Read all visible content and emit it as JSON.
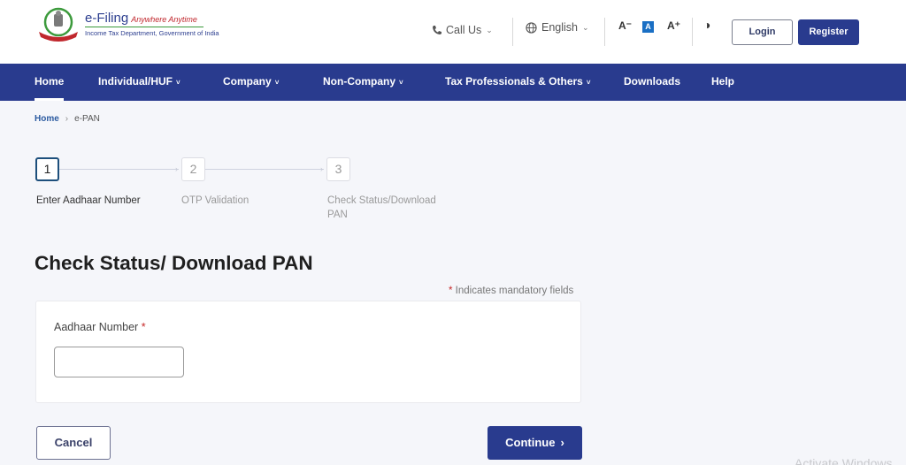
{
  "header": {
    "logo_title": "e-Filing",
    "logo_tagline": "Anywhere Anytime",
    "logo_subtitle": "Income Tax Department, Government of India",
    "call_us": "Call Us",
    "language": "English",
    "font_decrease": "A⁻",
    "font_default": "A",
    "font_increase": "A⁺",
    "contrast_icon": "◑",
    "login_label": "Login",
    "register_label": "Register"
  },
  "nav": {
    "items": [
      {
        "label": "Home",
        "dropdown": false,
        "active": true
      },
      {
        "label": "Individual/HUF",
        "dropdown": true
      },
      {
        "label": "Company",
        "dropdown": true
      },
      {
        "label": "Non-Company",
        "dropdown": true
      },
      {
        "label": "Tax Professionals & Others",
        "dropdown": true
      },
      {
        "label": "Downloads",
        "dropdown": false
      },
      {
        "label": "Help",
        "dropdown": false
      }
    ],
    "chevron": "˅"
  },
  "breadcrumb": {
    "home": "Home",
    "separator": "›",
    "current": "e-PAN"
  },
  "stepper": {
    "steps": [
      {
        "number": "1",
        "label": "Enter Aadhaar Number",
        "active": true
      },
      {
        "number": "2",
        "label": "OTP Validation",
        "active": false
      },
      {
        "number": "3",
        "label": "Check Status/Download PAN",
        "active": false
      }
    ]
  },
  "main": {
    "title": "Check Status/ Download PAN",
    "mandatory_asterisk": "*",
    "mandatory_note": " Indicates mandatory fields",
    "aadhaar_label": "Aadhaar Number",
    "aadhaar_required": "*",
    "aadhaar_value": "",
    "aadhaar_placeholder": ""
  },
  "actions": {
    "cancel_label": "Cancel",
    "continue_label": "Continue",
    "continue_chevron": "›"
  },
  "watermark": "Activate Windows",
  "colors": {
    "brand": "#293b8e",
    "required": "#c62828",
    "link": "#2b5aa0"
  }
}
